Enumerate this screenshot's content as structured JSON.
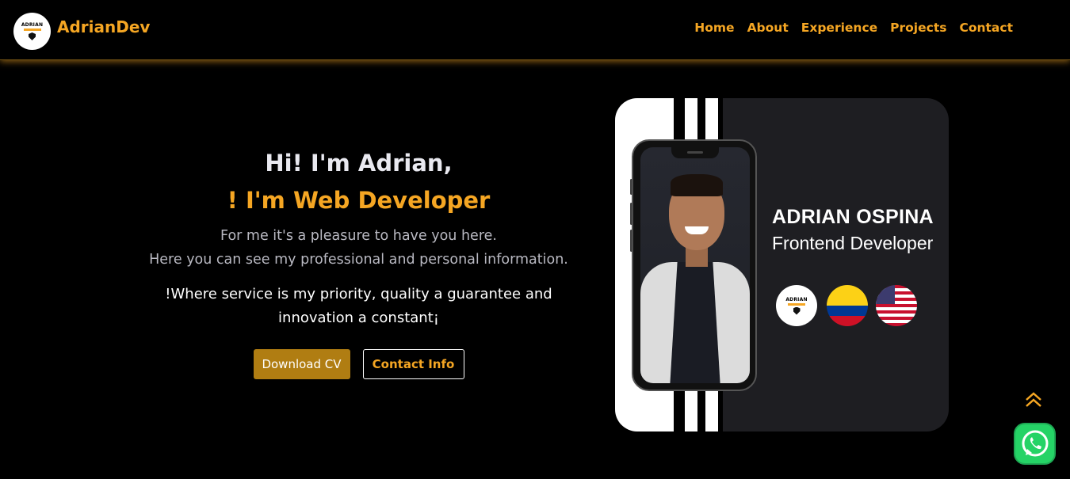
{
  "header": {
    "logo_line1": "ADRIAN",
    "logo_line2": "DEV",
    "brand": "AdrianDev",
    "nav": [
      "Home",
      "About",
      "Experience",
      "Projects",
      "Contact"
    ]
  },
  "hero": {
    "greeting": "Hi! I'm Adrian,",
    "role": "! I'm Web Developer",
    "intro_line1": "For me it's a pleasure to have you here.",
    "intro_line2": "Here you can see my professional and personal information.",
    "motto": "!Where service is my priority, quality a guarantee and innovation a constant¡",
    "download_cv": "Download CV",
    "contact_info": "Contact Info"
  },
  "card": {
    "name": "ADRIAN OSPINA",
    "title": "Frontend Developer",
    "badges": [
      "logo-badge",
      "colombia-flag",
      "usa-flag"
    ]
  },
  "colors": {
    "accent": "#f5a623",
    "cv_button": "#b07d12",
    "card_bg": "#1e1e22",
    "whatsapp": "#25d366"
  },
  "icons": [
    "double-chevron-up-icon",
    "whatsapp-icon"
  ]
}
